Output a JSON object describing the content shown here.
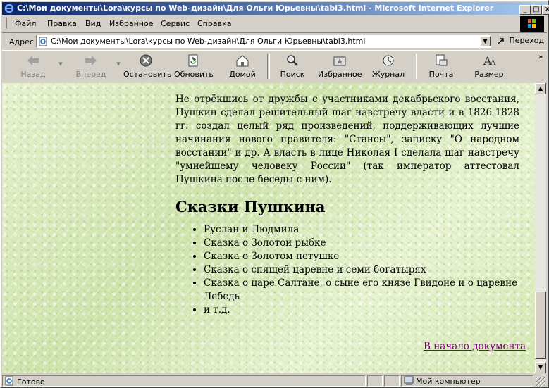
{
  "window": {
    "title": "C:\\Мои документы\\Lora\\курсы по Web-дизайн\\Для Ольги Юрьевны\\tabl3.html - Microsoft Internet Explorer"
  },
  "menu": [
    "Файл",
    "Правка",
    "Вид",
    "Избранное",
    "Сервис",
    "Справка"
  ],
  "address": {
    "label": "Адрес",
    "url": "C:\\Мои документы\\Lora\\курсы по Web-дизайн\\Для Ольги Юрьевны\\tabl3.html",
    "go_label": "Переход"
  },
  "toolbar": {
    "back": "Назад",
    "forward": "Вперед",
    "stop": "Остановить",
    "refresh": "Обновить",
    "home": "Домой",
    "search": "Поиск",
    "favorites": "Избранное",
    "history": "Журнал",
    "mail": "Почта",
    "size": "Размер"
  },
  "page": {
    "paragraph": "Не отрёкшись от дружбы с участниками декабрьского восстания, Пушкин сделал решительный шаг навстречу власти и в 1826-1828 гг. создал целый ряд произведений, поддерживающих лучшие начинания нового правителя: \"Стансы\", записку \"О народном восстании\" и др. А власть в лице Николая I сделала шаг навстречу \"умнейшему человеку России\" (так император аттестовал Пушкина после беседы с ним).",
    "heading": "Сказки Пушкина",
    "tales": [
      "Руслан и Людмила",
      "Сказка о Золотой рыбке",
      "Сказка о Золотом петушке",
      "Сказка о спящей царевне и семи богатырях",
      "Сказка о царе Салтане, о сыне его князе Гвидоне и о царевне Лебедь",
      "и т.д."
    ],
    "top_link": "В начало документа"
  },
  "status": {
    "text": "Готово",
    "zone": "Мой компьютер"
  },
  "colors": {
    "title_start": "#0a246a",
    "title_end": "#a6caf0",
    "link_visited": "#800080",
    "page_bg": "#dcecc0"
  }
}
